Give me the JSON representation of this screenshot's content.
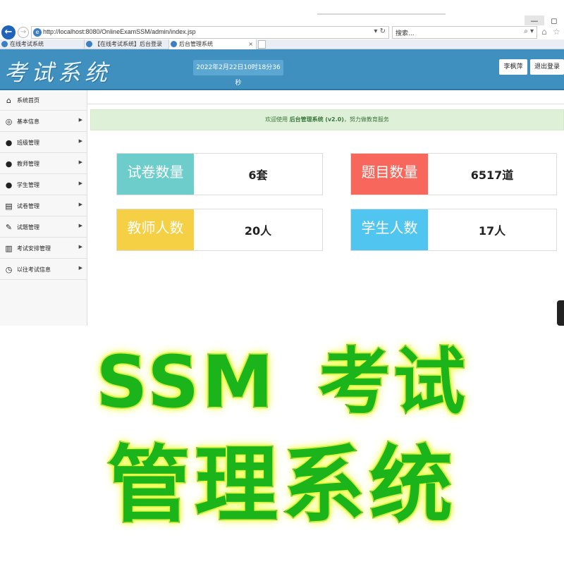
{
  "browser": {
    "address_url": "http://localhost:8080/OnlineExamSSM/admin/index.jsp",
    "search_placeholder": "搜索...",
    "tabs": [
      {
        "label": "在线考试系统"
      },
      {
        "label": "【在线考试系统】后台登录"
      },
      {
        "label": "后台管理系统"
      }
    ],
    "window_min": "—",
    "window_max": "◻"
  },
  "header": {
    "logo": "考试系统",
    "datetime": "2022年2月22日10时18分36秒",
    "user_button": "李枫萍",
    "logout_button": "退出登录"
  },
  "sidebar": {
    "items": [
      {
        "label": "系统首页",
        "icon": "home-icon",
        "has_arrow": false
      },
      {
        "label": "基本信息",
        "icon": "info-icon",
        "has_arrow": true
      },
      {
        "label": "班级管理",
        "icon": "group-icon",
        "has_arrow": true
      },
      {
        "label": "教师管理",
        "icon": "teacher-icon",
        "has_arrow": true
      },
      {
        "label": "学生管理",
        "icon": "student-icon",
        "has_arrow": true
      },
      {
        "label": "试卷管理",
        "icon": "paper-icon",
        "has_arrow": true
      },
      {
        "label": "试题管理",
        "icon": "edit-icon",
        "has_arrow": true
      },
      {
        "label": "考试安排管理",
        "icon": "books-icon",
        "has_arrow": true
      },
      {
        "label": "以往考试信息",
        "icon": "history-icon",
        "has_arrow": true
      }
    ]
  },
  "welcome": {
    "prefix": "欢迎使用 ",
    "system_name": "后台管理系统",
    "version": "(v2.0)",
    "suffix": "，努力做教育服务"
  },
  "stats": [
    {
      "label": "试卷数量",
      "value": "6套",
      "color": "#6ccdcb"
    },
    {
      "label": "题目数量",
      "value": "6517道",
      "color": "#f7675c"
    },
    {
      "label": "教师人数",
      "value": "20人",
      "color": "#f5d045"
    },
    {
      "label": "学生人数",
      "value": "17人",
      "color": "#50c5ef"
    }
  ],
  "banner": {
    "line1_part1": "SSM",
    "line1_part2": "考试",
    "line2": "管理系统",
    "fill_color": "#1bb51b",
    "glow_color": "#e9ff3a"
  }
}
